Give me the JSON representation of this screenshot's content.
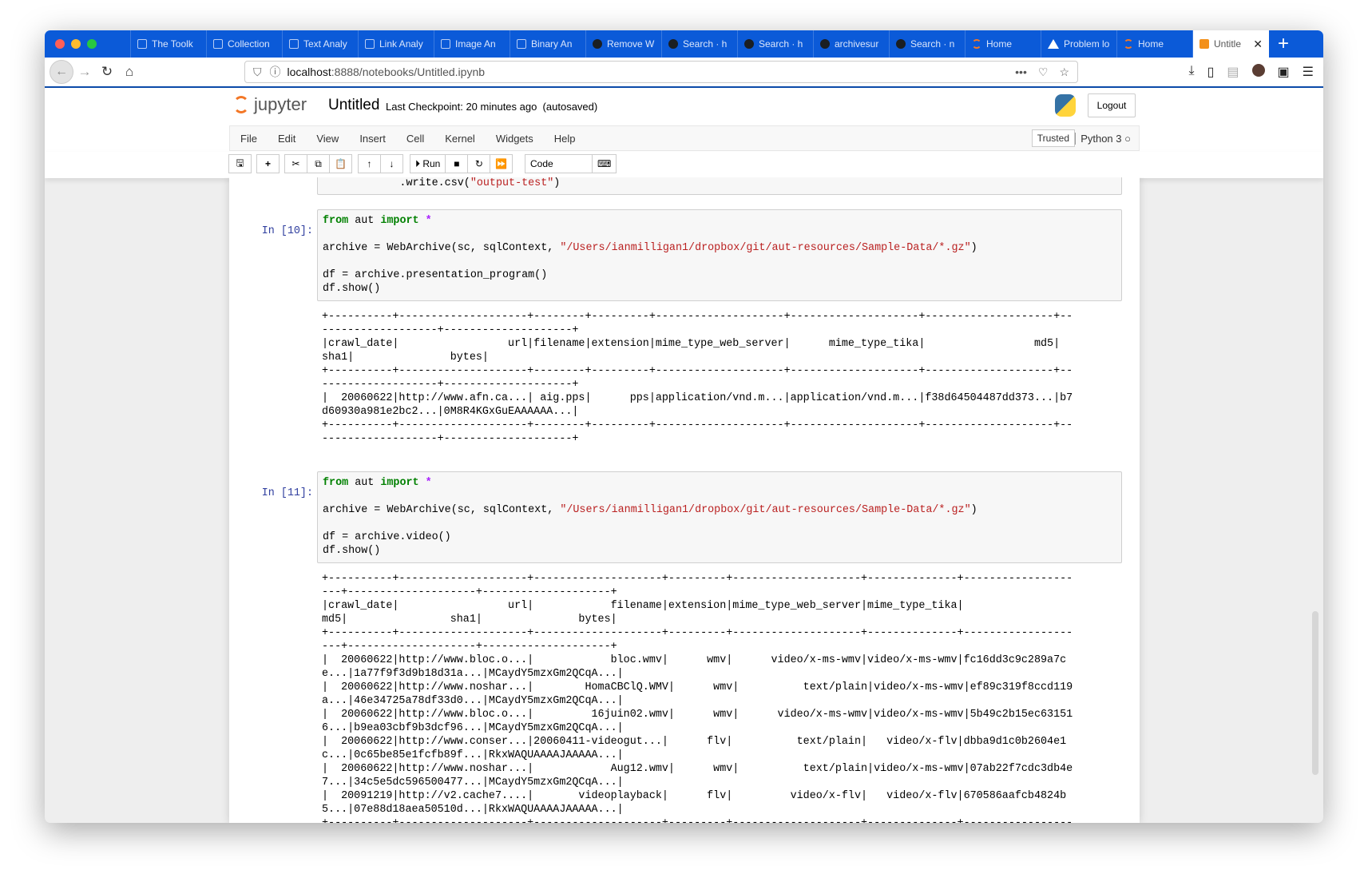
{
  "browser": {
    "tabs": [
      {
        "label": "The Toolk",
        "icon": "doc-icon"
      },
      {
        "label": "Collection",
        "icon": "doc-icon"
      },
      {
        "label": "Text Analy",
        "icon": "doc-icon"
      },
      {
        "label": "Link Analy",
        "icon": "doc-icon"
      },
      {
        "label": "Image An",
        "icon": "doc-icon"
      },
      {
        "label": "Binary An",
        "icon": "doc-icon"
      },
      {
        "label": "Remove W",
        "icon": "github-icon"
      },
      {
        "label": "Search · h",
        "icon": "github-icon"
      },
      {
        "label": "Search · h",
        "icon": "github-icon"
      },
      {
        "label": "archivesur",
        "icon": "github-icon"
      },
      {
        "label": "Search · n",
        "icon": "github-icon"
      },
      {
        "label": "Home",
        "icon": "jupyter-icon"
      },
      {
        "label": "Problem lo",
        "icon": "warning-icon"
      },
      {
        "label": "Home",
        "icon": "jupyter-icon"
      }
    ],
    "active_tab": {
      "label": "Untitle",
      "icon": "notebook-icon"
    },
    "url_host": "localhost",
    "url_path": ":8888/notebooks/Untitled.ipynb"
  },
  "jupyter": {
    "logo_text": "jupyter",
    "notebook_name": "Untitled",
    "checkpoint": "Last Checkpoint: 20 minutes ago  (autosaved)",
    "logout": "Logout",
    "menu": [
      "File",
      "Edit",
      "View",
      "Insert",
      "Cell",
      "Kernel",
      "Widgets",
      "Help"
    ],
    "trusted": "Trusted",
    "kernel": "Python 3",
    "run_label": "Run",
    "cell_type": "Code"
  },
  "cells": {
    "prev_tail": "            .write.csv(",
    "prev_tail_str": "\"output-test\"",
    "prev_tail_end": ")",
    "c10": {
      "prompt": "In [10]:",
      "path": "\"/Users/ianmilligan1/dropbox/git/aut-resources/Sample-Data/*.gz\"",
      "line3": "df = archive.presentation_program()",
      "line4": "df.show()",
      "output": [
        "+----------+--------------------+--------+---------+--------------------+--------------------+--------------------+--",
        "------------------+--------------------+",
        "|crawl_date|                 url|filename|extension|mime_type_web_server|      mime_type_tika|                 md5|",
        "sha1|               bytes|",
        "+----------+--------------------+--------+---------+--------------------+--------------------+--------------------+--",
        "------------------+--------------------+",
        "|  20060622|http://www.afn.ca...| aig.pps|      pps|application/vnd.m...|application/vnd.m...|f38d64504487dd373...|b7",
        "d60930a981e2bc2...|0M8R4KGxGuEAAAAAA...|",
        "+----------+--------------------+--------+---------+--------------------+--------------------+--------------------+--",
        "------------------+--------------------+"
      ]
    },
    "c11": {
      "prompt": "In [11]:",
      "path": "\"/Users/ianmilligan1/dropbox/git/aut-resources/Sample-Data/*.gz\"",
      "line3": "df = archive.video()",
      "line4": "df.show()",
      "output": [
        "+----------+--------------------+--------------------+---------+--------------------+--------------+-----------------",
        "---+--------------------+--------------------+",
        "|crawl_date|                 url|            filename|extension|mime_type_web_server|mime_type_tika|",
        "md5|                sha1|               bytes|",
        "+----------+--------------------+--------------------+---------+--------------------+--------------+-----------------",
        "---+--------------------+--------------------+",
        "|  20060622|http://www.bloc.o...|            bloc.wmv|      wmv|      video/x-ms-wmv|video/x-ms-wmv|fc16dd3c9c289a7c",
        "e...|1a77f9f3d9b18d31a...|MCaydY5mzxGm2QCqA...|",
        "|  20060622|http://www.noshar...|        HomaCBClQ.WMV|      wmv|          text/plain|video/x-ms-wmv|ef89c319f8ccd119",
        "a...|46e34725a78df33d0...|MCaydY5mzxGm2QCqA...|",
        "|  20060622|http://www.bloc.o...|         16juin02.wmv|      wmv|      video/x-ms-wmv|video/x-ms-wmv|5b49c2b15ec63151",
        "6...|b9ea03cbf9b3dcf96...|MCaydY5mzxGm2QCqA...|",
        "|  20060622|http://www.conser...|20060411-videogut...|      flv|          text/plain|   video/x-flv|dbba9d1c0b2604e1",
        "c...|0c65be85e1fcfb89f...|RkxWAQUAAAAJAAAAA...|",
        "|  20060622|http://www.noshar...|            Aug12.wmv|      wmv|          text/plain|video/x-ms-wmv|07ab22f7cdc3db4e",
        "7...|34c5e5dc596500477...|MCaydY5mzxGm2QCqA...|",
        "|  20091219|http://v2.cache7....|       videoplayback|      flv|         video/x-flv|   video/x-flv|670586aafcb4824b",
        "5...|07e88d18aea50510d...|RkxWAQUAAAAJAAAAA...|",
        "+----------+--------------------+--------------------+---------+--------------------+--------------+-----------------"
      ]
    }
  },
  "code_tokens": {
    "from": "from",
    "mod": " aut ",
    "import": "import",
    "star": " *",
    "assign": "archive = WebArchive(sc, sqlContext, ",
    "close": ")"
  }
}
